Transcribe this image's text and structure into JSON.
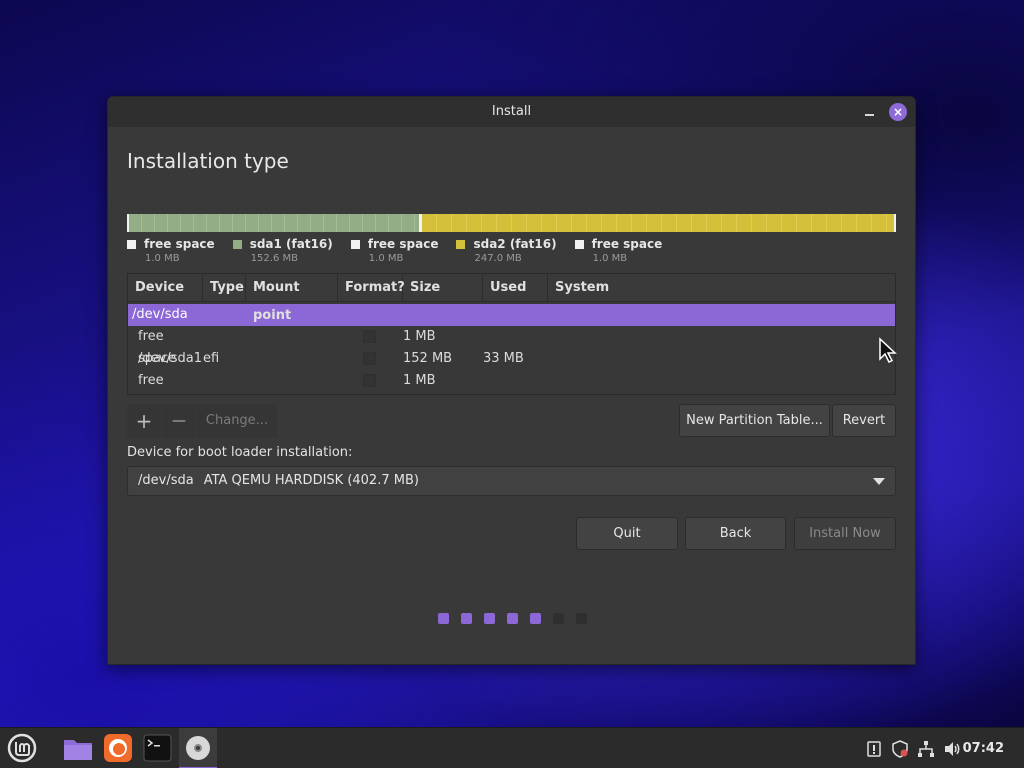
{
  "window": {
    "title": "Install",
    "close_glyph": "×"
  },
  "page": {
    "title": "Installation type"
  },
  "disk_bar": {
    "segments": [
      {
        "name": "free space",
        "size": "1.0 MB",
        "color": "#f2f2f2"
      },
      {
        "name": "sda1 (fat16)",
        "size": "152.6 MB",
        "color": "#93ad86"
      },
      {
        "name": "free space",
        "size": "1.0 MB",
        "color": "#f2f2f2"
      },
      {
        "name": "sda2 (fat16)",
        "size": "247.0 MB",
        "color": "#d4c03a"
      },
      {
        "name": "free space",
        "size": "1.0 MB",
        "color": "#f2f2f2"
      }
    ]
  },
  "table": {
    "headers": {
      "device": "Device",
      "type": "Type",
      "mount": "Mount point",
      "format": "Format?",
      "size": "Size",
      "used": "Used",
      "system": "System"
    },
    "selected": "/dev/sda",
    "rows": [
      {
        "device": "free space",
        "type": "",
        "mount": "",
        "size": "1 MB",
        "used": "",
        "system": ""
      },
      {
        "device": "/dev/sda1",
        "type": "efi",
        "mount": "",
        "size": "152 MB",
        "used": "33 MB",
        "system": ""
      },
      {
        "device": "free space",
        "type": "",
        "mount": "",
        "size": "1 MB",
        "used": "",
        "system": ""
      }
    ]
  },
  "toolbar": {
    "add": "+",
    "remove": "—",
    "change": "Change...",
    "new_table": "New Partition Table...",
    "revert": "Revert"
  },
  "boot": {
    "label": "Device for boot loader installation:",
    "device": "/dev/sda",
    "model": "ATA QEMU HARDDISK (402.7 MB)"
  },
  "actions": {
    "quit": "Quit",
    "back": "Back",
    "install": "Install Now"
  },
  "progress": {
    "total_steps": 7,
    "completed_steps": 5,
    "active_color": "#8c67d6",
    "inactive_color": "#2f2f2f"
  },
  "taskbar": {
    "clock": "07:42"
  },
  "colors": {
    "accent": "#8c67d6"
  }
}
